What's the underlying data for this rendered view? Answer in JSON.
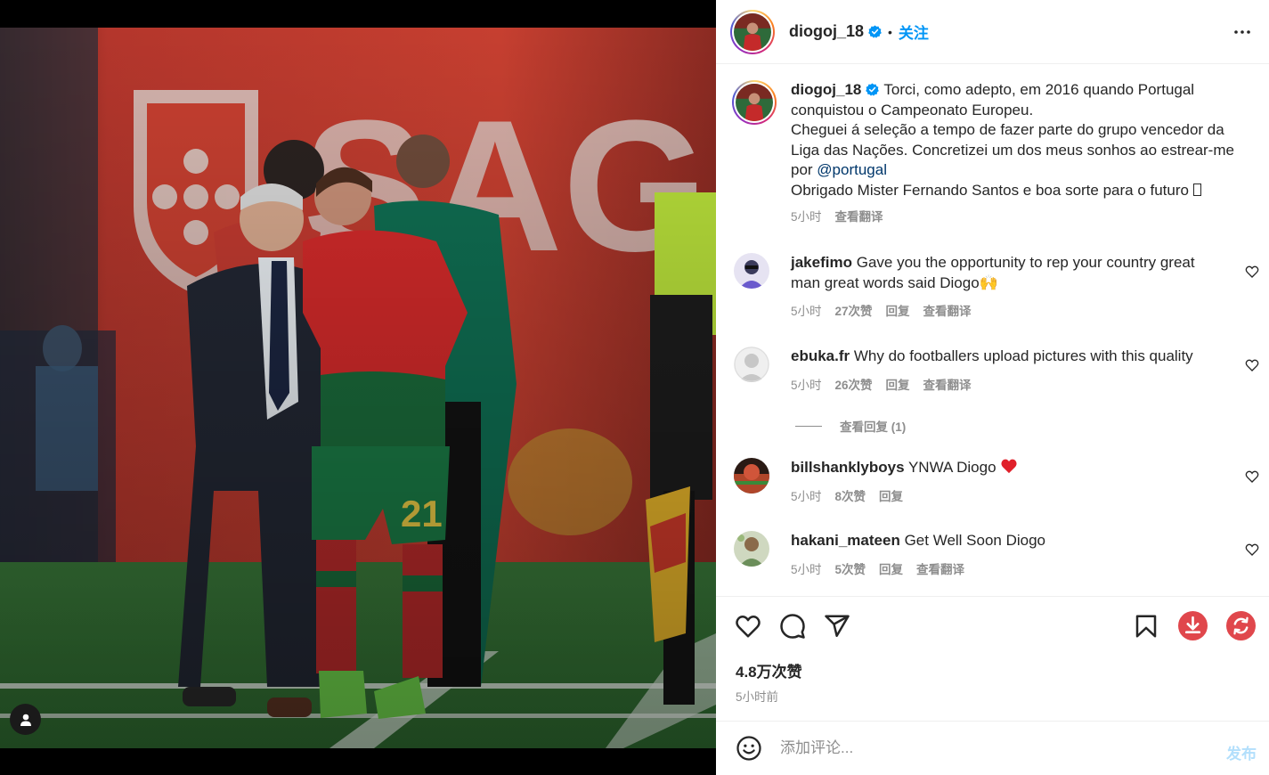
{
  "post": {
    "username": "diogoj_18",
    "follow_label": "关注",
    "separator": "•",
    "caption_lines": [
      "Torci, como adepto, em 2016 quando Portugal",
      "conquistou o Campeonato Europeu.",
      "Cheguei á seleção a tempo de fazer parte do grupo vencedor da",
      "Liga das Nações. Concretizei um dos meus sonhos ao estrear-me"
    ],
    "caption_por": "por ",
    "caption_mention": "@portugal",
    "caption_last": "Obrigado Mister Fernando Santos e boa sorte para o futuro ",
    "caption_time": "5小时",
    "caption_translate": "查看翻译"
  },
  "comments": [
    {
      "user": "jakefimo",
      "text": "Gave you the opportunity to rep your country great man great words said Diogo",
      "emoji": "🙌",
      "time": "5小时",
      "likes": "27次赞",
      "reply": "回复",
      "translate": "查看翻译",
      "avatar_color": "#6a5acd"
    },
    {
      "user": "ebuka.fr",
      "text": "Why do footballers upload pictures with this quality",
      "time": "5小时",
      "likes": "26次赞",
      "reply": "回复",
      "translate": "查看翻译",
      "avatar_color": "#dbdbdb"
    },
    {
      "user": "billshanklyboys",
      "text": "YNWA Diogo ",
      "time": "5小时",
      "likes": "8次赞",
      "reply": "回复",
      "avatar_color": "#b0462a"
    },
    {
      "user": "hakani_mateen",
      "text": "Get Well Soon Diogo",
      "time": "5小时",
      "likes": "5次赞",
      "reply": "回复",
      "translate": "查看翻译",
      "avatar_color": "#6b8e5a"
    }
  ],
  "view_replies": "查看回复 (1)",
  "stats": {
    "likes": "4.8万次赞",
    "posted": "5小时前"
  },
  "composer": {
    "placeholder": "添加评论...",
    "post_label": "发布"
  },
  "colors": {
    "link": "#0095f6",
    "muted": "#8e8e8e",
    "heart_red": "#ed4956",
    "download_red": "#e0474c"
  },
  "icons": [
    "verified-badge-icon",
    "more-options-icon",
    "heart-icon",
    "comment-icon",
    "share-icon",
    "bookmark-icon",
    "download-icon",
    "refresh-icon",
    "emoji-icon",
    "tag-user-icon"
  ]
}
